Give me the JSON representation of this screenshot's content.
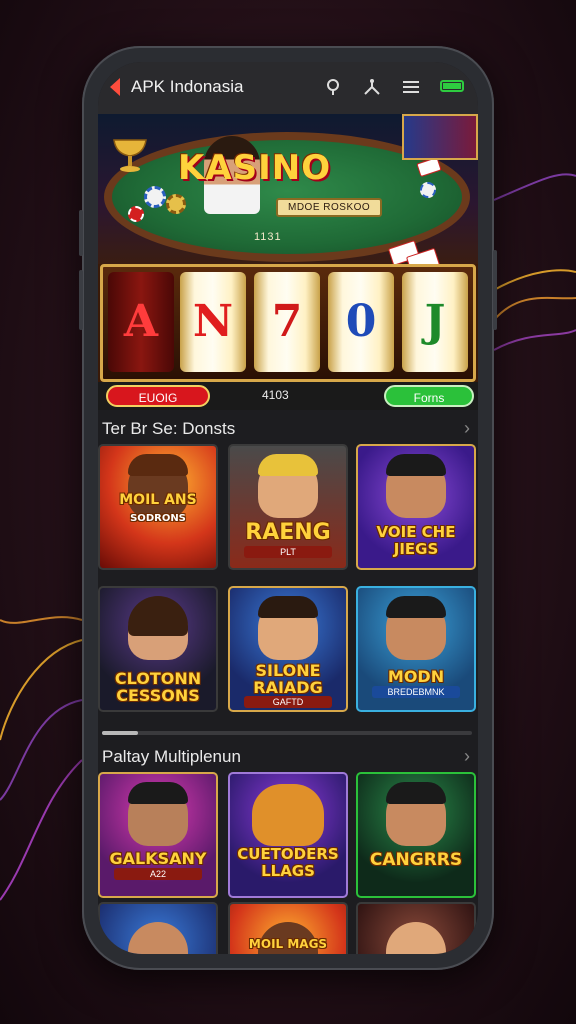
{
  "status_bar": {
    "app_title": "APK Indonasia"
  },
  "hero": {
    "logo_text": "KASINO",
    "sub_plaque": "MDOE ROSKOO",
    "table_number": "1131"
  },
  "slot_machine": {
    "reels": [
      "A",
      "N",
      "7",
      "0",
      "J"
    ],
    "left_button": "EUOIG",
    "center_value": "4103",
    "right_button": "Forns"
  },
  "sections": [
    {
      "title": "Ter Br Se: Donsts",
      "games": [
        {
          "title": "MOIL ANS",
          "subtitle": "SODRONS"
        },
        {
          "title": "RAENG",
          "subtitle": "PLT"
        },
        {
          "title": "VOIE CHE JIEGS",
          "subtitle": ""
        },
        {
          "title": "CLOTONN CESSONS",
          "subtitle": ""
        },
        {
          "title": "SILONE RAIADG",
          "subtitle": "GAFTD"
        },
        {
          "title": "MODN",
          "subtitle": "BREDEBMNK"
        }
      ]
    },
    {
      "title": "Paltay Multiplenun",
      "games": [
        {
          "title": "GALKSANY",
          "subtitle": "A22"
        },
        {
          "title": "CUETODERS LLAGS",
          "subtitle": ""
        },
        {
          "title": "CANGRRS",
          "subtitle": ""
        },
        {
          "title": "",
          "subtitle": ""
        },
        {
          "title": "MOIL MAGS",
          "subtitle": ""
        },
        {
          "title": "",
          "subtitle": ""
        }
      ]
    }
  ],
  "colors": {
    "accent_gold": "#ffd23c",
    "pill_red": "#d8161d",
    "pill_green": "#2bc13a"
  }
}
